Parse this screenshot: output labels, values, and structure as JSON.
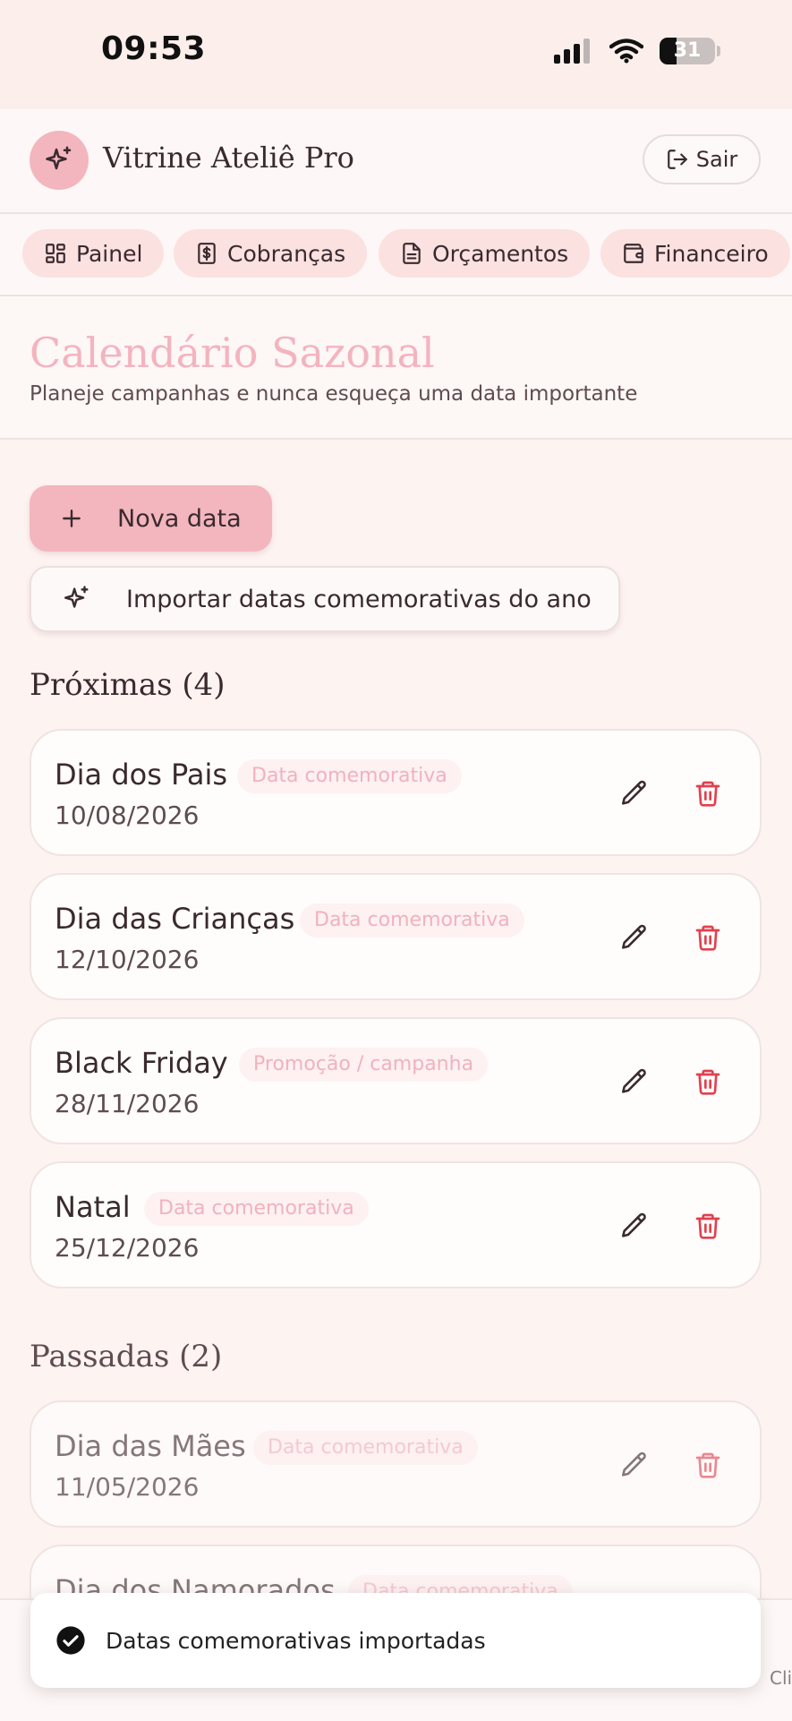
{
  "status_bar": {
    "time": "09:53",
    "battery": "31",
    "battery_level": 0.31
  },
  "header": {
    "app_name": "Vitrine Ateliê Pro",
    "logout_label": "Sair",
    "logo_icon": "sparkles-icon"
  },
  "tabs": [
    {
      "label": "Painel",
      "icon": "dashboard-icon"
    },
    {
      "label": "Cobranças",
      "icon": "dollar-icon"
    },
    {
      "label": "Orçamentos",
      "icon": "document-icon"
    },
    {
      "label": "Financeiro",
      "icon": "wallet-icon"
    }
  ],
  "page": {
    "title": "Calendário Sazonal",
    "subtitle": "Planeje campanhas e nunca esqueça uma data importante"
  },
  "actions": {
    "new_label": "Nova data",
    "import_label": "Importar datas comemorativas do ano"
  },
  "upcoming": {
    "title": "Próximas (4)",
    "items": [
      {
        "name": "Dia dos Pais",
        "badge": "Data comemorativa",
        "date": "10/08/2026"
      },
      {
        "name": "Dia das Crianças",
        "badge": "Data comemorativa",
        "date": "12/10/2026"
      },
      {
        "name": "Black Friday",
        "badge": "Promoção / campanha",
        "date": "28/11/2026"
      },
      {
        "name": "Natal",
        "badge": "Data comemorativa",
        "date": "25/12/2026"
      }
    ]
  },
  "past": {
    "title": "Passadas (2)",
    "items": [
      {
        "name": "Dia das Mães",
        "badge": "Data comemorativa",
        "date": "11/05/2026"
      },
      {
        "name": "Dia dos Namorados",
        "badge": "Data comemorativa",
        "date": ""
      }
    ]
  },
  "toast": {
    "message": "Datas comemorativas importadas"
  },
  "footer_clip": "Cli",
  "colors": {
    "accent_pink": "#f3b6be",
    "delete_red": "#e0414f",
    "background": "#fdf3f1"
  }
}
